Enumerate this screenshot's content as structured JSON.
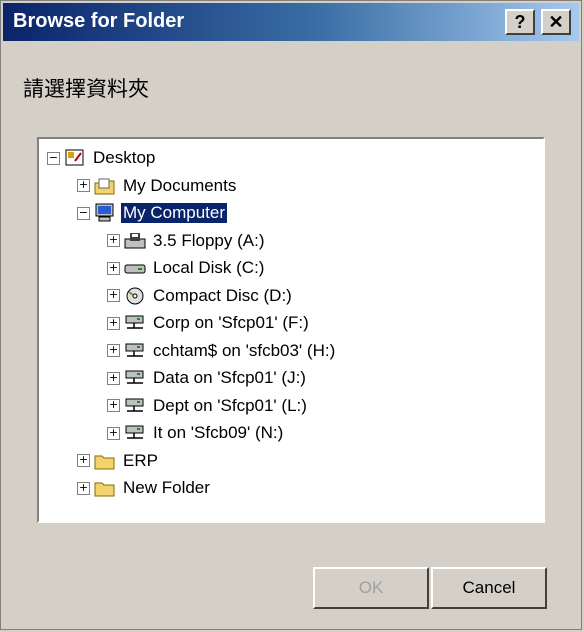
{
  "window": {
    "title": "Browse for Folder",
    "help_label": "?",
    "close_label": "✕"
  },
  "prompt": "請選擇資料夾",
  "tree": [
    {
      "label": "Desktop",
      "expander": "−",
      "icon": "desktop-icon",
      "depth": 0
    },
    {
      "label": "My Documents",
      "expander": "+",
      "icon": "my-documents-icon",
      "depth": 1
    },
    {
      "label": "My Computer",
      "expander": "−",
      "icon": "my-computer-icon",
      "depth": 1,
      "selected": true
    },
    {
      "label": "3.5 Floppy (A:)",
      "expander": "+",
      "icon": "floppy-drive-icon",
      "depth": 2
    },
    {
      "label": "Local Disk (C:)",
      "expander": "+",
      "icon": "hard-disk-icon",
      "depth": 2
    },
    {
      "label": "Compact Disc (D:)",
      "expander": "+",
      "icon": "cd-drive-icon",
      "depth": 2
    },
    {
      "label": "Corp on 'Sfcp01' (F:)",
      "expander": "+",
      "icon": "network-drive-icon",
      "depth": 2
    },
    {
      "label": "cchtam$ on 'sfcb03' (H:)",
      "expander": "+",
      "icon": "network-drive-icon",
      "depth": 2
    },
    {
      "label": "Data on 'Sfcp01' (J:)",
      "expander": "+",
      "icon": "network-drive-icon",
      "depth": 2
    },
    {
      "label": "Dept on 'Sfcp01' (L:)",
      "expander": "+",
      "icon": "network-drive-icon",
      "depth": 2
    },
    {
      "label": "It on 'Sfcb09' (N:)",
      "expander": "+",
      "icon": "network-drive-icon",
      "depth": 2
    },
    {
      "label": "ERP",
      "expander": "+",
      "icon": "folder-icon",
      "depth": 1
    },
    {
      "label": "New Folder",
      "expander": "+",
      "icon": "folder-icon",
      "depth": 1
    }
  ],
  "buttons": {
    "ok_label": "OK",
    "cancel_label": "Cancel",
    "ok_enabled": false
  },
  "colors": {
    "selection": "#0a246a",
    "dialog_bg": "#d4d0c8"
  }
}
